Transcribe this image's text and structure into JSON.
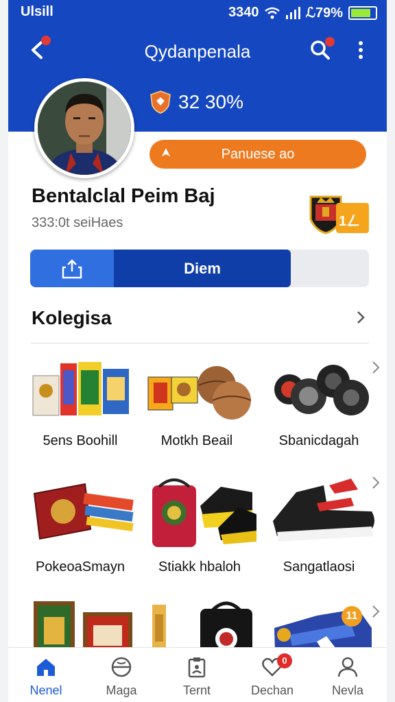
{
  "status_bar": {
    "carrier": "Ulsill",
    "time": "3340",
    "battery": "ℒ79%"
  },
  "app": {
    "title": "Qydanpenala"
  },
  "profile": {
    "stat": "32 30%",
    "premium_label": "Panuese ao",
    "name": "Bentalclal Peim Baj",
    "subtitle": "333:0t seiHaes",
    "badge_text": "1ㄥ"
  },
  "tabs_row": {
    "active_label": "Diem"
  },
  "section": {
    "title": "Kolegisa"
  },
  "categories": [
    {
      "label": "5ens Boohill"
    },
    {
      "label": "Motkh Beail"
    },
    {
      "label": "Sbanicdagah"
    },
    {
      "label": "PokeoaSmayn"
    },
    {
      "label": "Stiakk hbaloh"
    },
    {
      "label": "Sangatlaosi"
    }
  ],
  "nav": [
    {
      "label": "Nenel",
      "icon": "home-icon"
    },
    {
      "label": "Maga",
      "icon": "ball-icon"
    },
    {
      "label": "Ternt",
      "icon": "clipboard-icon"
    },
    {
      "label": "Dechan",
      "icon": "heart-icon"
    },
    {
      "label": "Nevla",
      "icon": "person-icon"
    }
  ],
  "nav_badges": {
    "dechan": "0"
  },
  "third_row_badge": "11",
  "colors": {
    "header": "#1547c0",
    "accent": "#ee7a1f",
    "active_tab": "#1e5bd6"
  }
}
